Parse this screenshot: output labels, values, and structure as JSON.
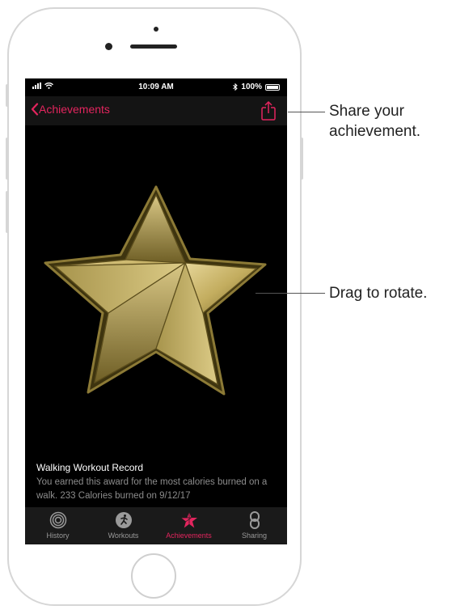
{
  "status_bar": {
    "time": "10:09 AM",
    "battery": "100%"
  },
  "nav": {
    "back_label": "Achievements"
  },
  "award": {
    "title": "Walking Workout Record",
    "description": "You earned this award for the most calories burned on a walk. 233 Calories burned on 9/12/17"
  },
  "tabs": [
    {
      "label": "History",
      "icon": "history-rings-icon",
      "active": false
    },
    {
      "label": "Workouts",
      "icon": "workout-runner-icon",
      "active": false
    },
    {
      "label": "Achievements",
      "icon": "star-award-icon",
      "active": true
    },
    {
      "label": "Sharing",
      "icon": "sharing-link-icon",
      "active": false
    }
  ],
  "callouts": {
    "share_line1": "Share your",
    "share_line2": "achievement.",
    "rotate": "Drag to rotate."
  },
  "colors": {
    "accent": "#e3255e",
    "gold": "#c9b46a",
    "screen_bg": "#000000"
  }
}
